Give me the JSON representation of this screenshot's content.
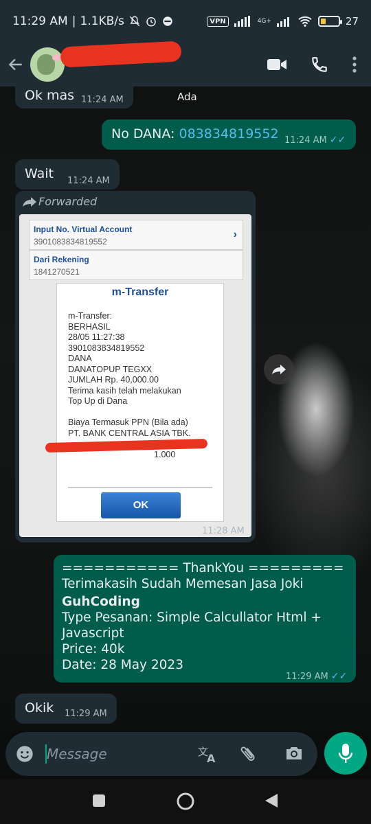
{
  "status": {
    "time": "11:29 AM",
    "speed": "1.1KB/s",
    "vpn": "VPN",
    "network": "4G+",
    "battery": "27",
    "battery_level": 0.27
  },
  "appbar": {
    "icons": [
      "back-arrow-icon",
      "video-call-icon",
      "phone-call-icon",
      "more-vert-icon"
    ]
  },
  "messages": {
    "m1": {
      "text": "Ok mas",
      "time": "11:24 AM"
    },
    "m1_side": {
      "text": "Ada"
    },
    "m2": {
      "prefix": "No DANA: ",
      "number": "083834819552",
      "time": "11:24 AM"
    },
    "m3": {
      "text": "Wait",
      "time": "11:24 AM"
    },
    "fwd": {
      "label": "Forwarded",
      "time": "11:28 AM",
      "rows": [
        {
          "label": "Input No. Virtual Account",
          "value": "3901083834819552"
        },
        {
          "label": "Dari Rekening",
          "value": "1841270521"
        }
      ],
      "modal_title": "m-Transfer",
      "modal_lines": [
        "m-Transfer:",
        "BERHASIL",
        "28/05 11:27:38",
        "3901083834819552",
        "DANA",
        "DANATOPUP TEGXX",
        "JUMLAH Rp. 40,000.00",
        "Terima kasih telah melakukan",
        "Top Up di Dana",
        "",
        "Biaya Termasuk PPN (Bila ada)",
        "PT. BANK CENTRAL ASIA TBK.",
        "",
        "                                    1.000"
      ],
      "ok": "OK"
    },
    "m4": {
      "line1": "=========== ThankYou =========",
      "line2": "Terimakasih Sudah Memesan Jasa Joki",
      "line3": "GuhCoding",
      "line4": "Type Pesanan: Simple Calcullator Html +",
      "line5": "Javascript",
      "line6": "Price: 40k",
      "line7": "Date: 28 May 2023",
      "time": "11:29 AM"
    },
    "m5": {
      "text": "Okik",
      "time": "11:29 AM"
    }
  },
  "input": {
    "placeholder": "Message"
  }
}
